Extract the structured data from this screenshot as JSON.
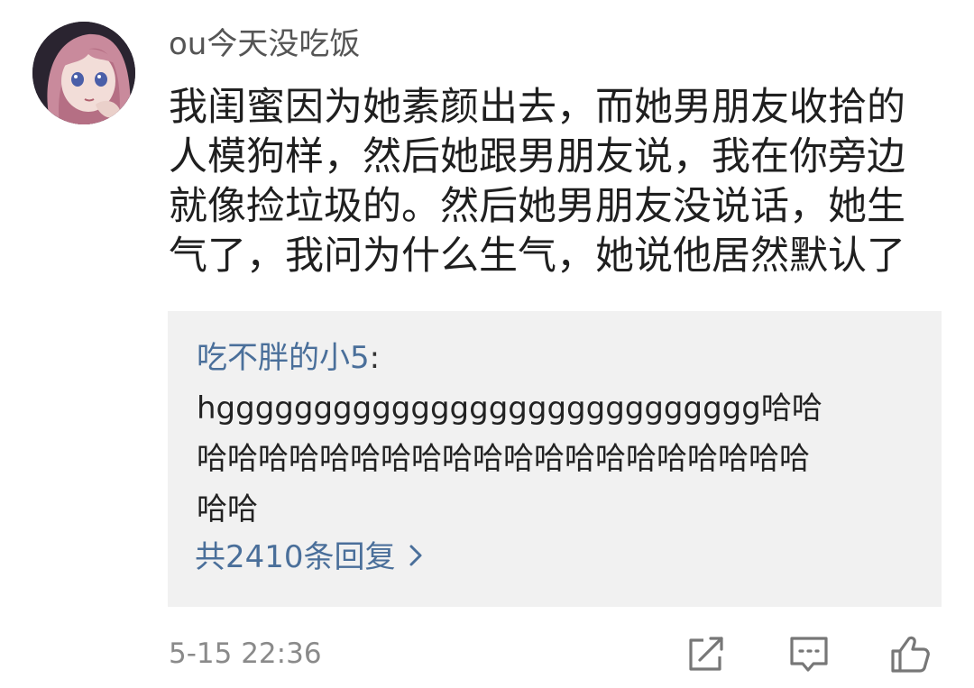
{
  "comment": {
    "username": "ou今天没吃饭",
    "content_lines": [
      "我闺蜜因为她素颜出去，而她男朋友收拾的",
      "人模狗样，然后她跟男朋友说，我在你旁边",
      "就像捡垃圾的。然后她男朋友没说话，她生",
      "气了，我问为什么生气，她说他居然默认了"
    ],
    "timestamp": "5-15 22:36",
    "avatar_icon": "avatar-image"
  },
  "reply": {
    "author": "吃不胖的小5",
    "colon": ":",
    "text_lines": [
      "hgggggggggggggggggggggggggggg哈哈",
      "哈哈哈哈哈哈哈哈哈哈哈哈哈哈哈哈哈哈哈哈",
      "哈哈"
    ],
    "reply_count_label": "共2410条回复",
    "chevron_icon": "chevron-right-icon"
  },
  "actions": {
    "share_icon": "share-icon",
    "comment_icon": "comment-icon",
    "like_icon": "thumbs-up-icon"
  },
  "colors": {
    "link": "#4a6f9a",
    "reply_bg": "#f1f1f1",
    "meta": "#8a8a8a"
  }
}
